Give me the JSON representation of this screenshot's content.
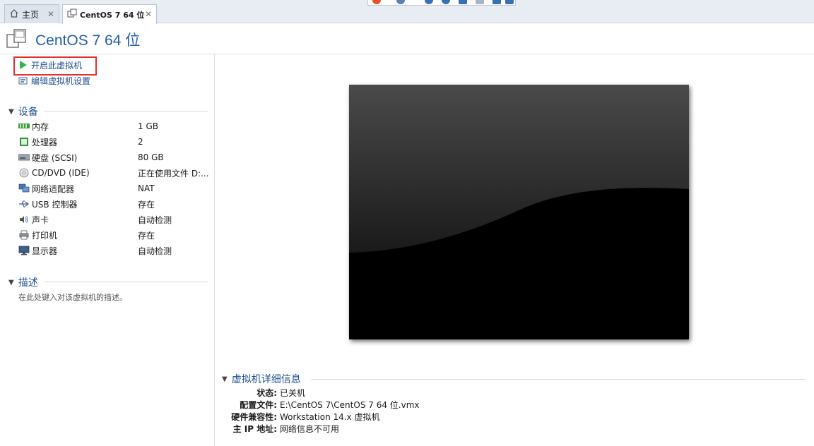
{
  "tabs": [
    {
      "label": "主页",
      "icon": "home-icon",
      "close": "✕"
    },
    {
      "label": "CentOS 7 64 位",
      "icon": "vm-tab-icon",
      "close": "✕"
    }
  ],
  "vm": {
    "title": "CentOS 7 64 位"
  },
  "actions": {
    "power_on": "开启此虚拟机",
    "edit_settings": "编辑虚拟机设置"
  },
  "devices": {
    "heading": "设备",
    "items": [
      {
        "name": "内存",
        "value": "1 GB",
        "icon": "memory-icon"
      },
      {
        "name": "处理器",
        "value": "2",
        "icon": "processor-icon"
      },
      {
        "name": "硬盘 (SCSI)",
        "value": "80 GB",
        "icon": "hard-disk-icon"
      },
      {
        "name": "CD/DVD (IDE)",
        "value": "正在使用文件 D:...",
        "icon": "cd-dvd-icon"
      },
      {
        "name": "网络适配器",
        "value": "NAT",
        "icon": "network-adapter-icon"
      },
      {
        "name": "USB 控制器",
        "value": "存在",
        "icon": "usb-icon"
      },
      {
        "name": "声卡",
        "value": "自动检测",
        "icon": "sound-card-icon"
      },
      {
        "name": "打印机",
        "value": "存在",
        "icon": "printer-icon"
      },
      {
        "name": "显示器",
        "value": "自动检测",
        "icon": "display-icon"
      }
    ]
  },
  "description": {
    "heading": "描述",
    "placeholder": "在此处键入对该虚拟机的描述。"
  },
  "details": {
    "heading": "虚拟机详细信息",
    "rows": [
      {
        "label": "状态:",
        "value": "已关机"
      },
      {
        "label": "配置文件:",
        "value": "E:\\CentOS 7\\CentOS 7 64 位.vmx"
      },
      {
        "label": "硬件兼容性:",
        "value": "Workstation 14.x 虚拟机"
      },
      {
        "label": "主 IP 地址:",
        "value": "网络信息不可用"
      }
    ]
  },
  "colors": {
    "accent": "#1f5fa8",
    "highlight": "#e03030",
    "play": "#2fb34a"
  }
}
